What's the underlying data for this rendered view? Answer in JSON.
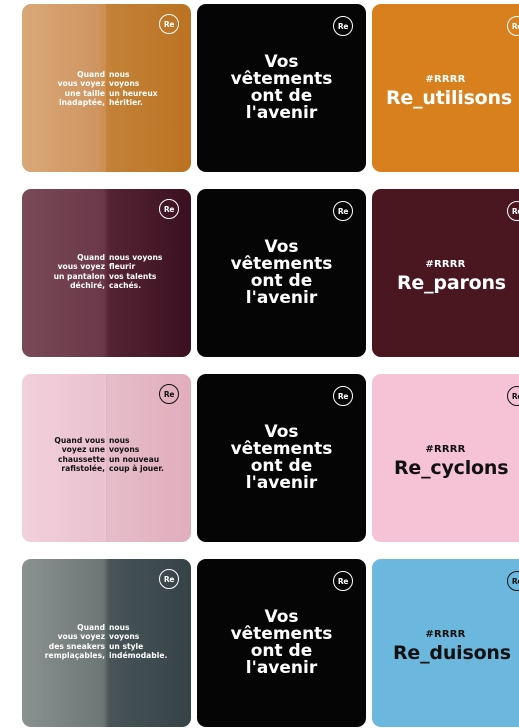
{
  "slogan": [
    "Vos",
    "vêtements",
    "ont de",
    "l'avenir"
  ],
  "logo_text": "Re",
  "hashtag": "#RRRR",
  "rows": [
    {
      "caption_left": [
        "Quand",
        "vous voyez",
        "une taille",
        "inadaptée,"
      ],
      "caption_right": [
        "nous",
        "voyons",
        "un heureux",
        "héritier."
      ],
      "tag_word": "Re_utilisons",
      "tag_color": "#d9801e",
      "tag_text_color": "#ffffff"
    },
    {
      "caption_left": [
        "Quand",
        "vous voyez",
        "un pantalon",
        "déchiré,"
      ],
      "caption_right": [
        "nous voyons",
        "fleurir",
        "vos talents",
        "cachés."
      ],
      "tag_word": "Re_parons",
      "tag_color": "#4a1620",
      "tag_text_color": "#ffffff"
    },
    {
      "caption_left": [
        "Quand vous",
        "voyez une",
        "chaussette",
        "rafistolée,"
      ],
      "caption_right": [
        "nous",
        "voyons",
        "un nouveau",
        "coup à jouer."
      ],
      "tag_word": "Re_cyclons",
      "tag_color": "#f6c3d6",
      "tag_text_color": "#111111"
    },
    {
      "caption_left": [
        "Quand",
        "vous voyez",
        "des sneakers",
        "remplaçables,"
      ],
      "caption_right": [
        "nous",
        "voyons",
        "un style",
        "indémodable."
      ],
      "tag_word": "Re_duisons",
      "tag_color": "#6cb7de",
      "tag_text_color": "#111111"
    }
  ]
}
